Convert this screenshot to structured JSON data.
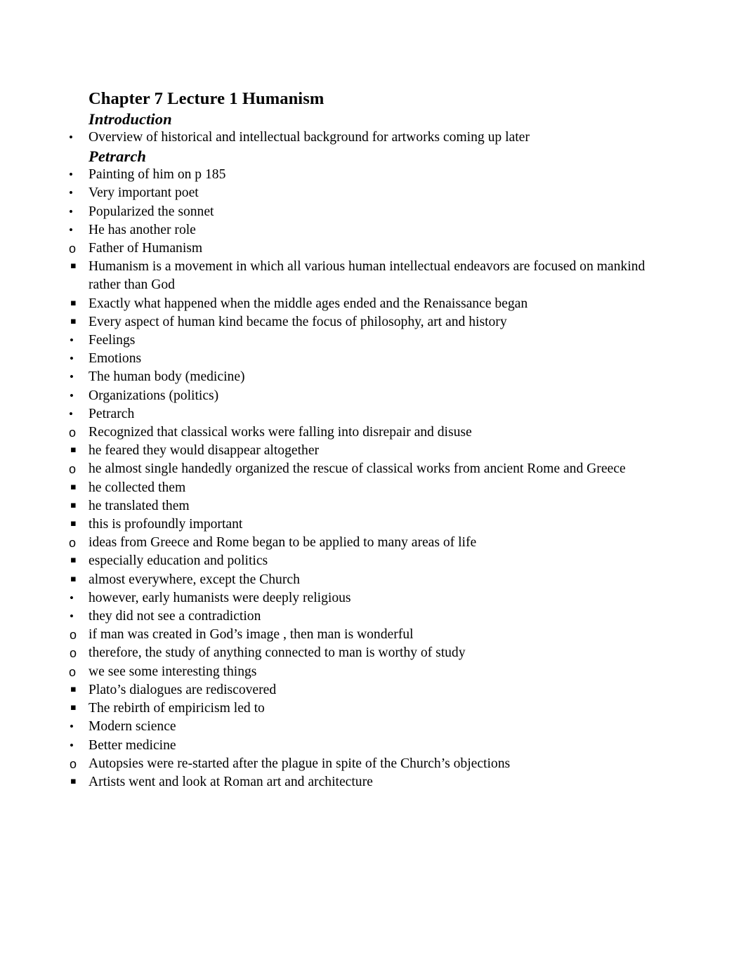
{
  "document": {
    "title": "Chapter 7 Lecture 1 Humanism",
    "page_background": "#ffffff",
    "text_color": "#000000"
  },
  "bullet_glyphs": {
    "level1": "•",
    "level2": "o",
    "level3": "▪",
    "level4": "•",
    "level5": "o"
  },
  "sections": [
    {
      "heading": "Introduction",
      "items": [
        {
          "level": 1,
          "text": "Overview of historical and intellectual background for artworks coming up later"
        }
      ]
    },
    {
      "heading": "Petrarch",
      "items": [
        {
          "level": 1,
          "text": "Painting of him on p 185"
        },
        {
          "level": 1,
          "text": "Very important poet"
        },
        {
          "level": 1,
          "text": "Popularized the sonnet"
        },
        {
          "level": 1,
          "text": "He has another role"
        },
        {
          "level": 2,
          "text": "Father of Humanism"
        },
        {
          "level": 3,
          "text": "Humanism is a movement in which all various human intellectual endeavors are focused on mankind rather than God"
        },
        {
          "level": 3,
          "text": "Exactly what happened when the middle ages ended and the Renaissance began"
        },
        {
          "level": 3,
          "text": "Every aspect of human kind became the focus of philosophy, art and history"
        },
        {
          "level": 4,
          "text": "Feelings"
        },
        {
          "level": 4,
          "text": "Emotions"
        },
        {
          "level": 4,
          "text": "The human body (medicine)"
        },
        {
          "level": 4,
          "text": "Organizations (politics)"
        },
        {
          "level": 1,
          "text": "Petrarch"
        },
        {
          "level": 2,
          "text": "Recognized that classical works were falling into disrepair and disuse"
        },
        {
          "level": 3,
          "text": "he feared they would disappear altogether"
        },
        {
          "level": 2,
          "text": "he  almost single handedly organized the rescue of classical works from ancient Rome and Greece"
        },
        {
          "level": 3,
          "text": "he collected them"
        },
        {
          "level": 3,
          "text": "he translated them"
        },
        {
          "level": 3,
          "text": "this is profoundly important"
        },
        {
          "level": 2,
          "text": "ideas from Greece and Rome began to be applied to many areas of life"
        },
        {
          "level": 3,
          "text": "especially education and politics"
        },
        {
          "level": 3,
          "text": "almost everywhere, except the Church"
        },
        {
          "level": 4,
          "text": "however, early humanists were deeply religious"
        },
        {
          "level": 4,
          "text": "they did not see a contradiction"
        },
        {
          "level": 5,
          "text": "if man was created in God’s image , then man is wonderful"
        },
        {
          "level": 5,
          "text": "therefore, the study of anything connected to man is worthy of study"
        },
        {
          "level": 2,
          "text": "we see some interesting things"
        },
        {
          "level": 3,
          "text": "Plato’s dialogues are rediscovered"
        },
        {
          "level": 3,
          "text": "The rebirth of empiricism led to"
        },
        {
          "level": 4,
          "text": "Modern science"
        },
        {
          "level": 4,
          "text": "Better medicine"
        },
        {
          "level": 5,
          "text": "Autopsies were re-started after the plague in spite of the Church’s objections"
        },
        {
          "level": 3,
          "text": "Artists went and look at Roman art and architecture"
        }
      ]
    }
  ]
}
